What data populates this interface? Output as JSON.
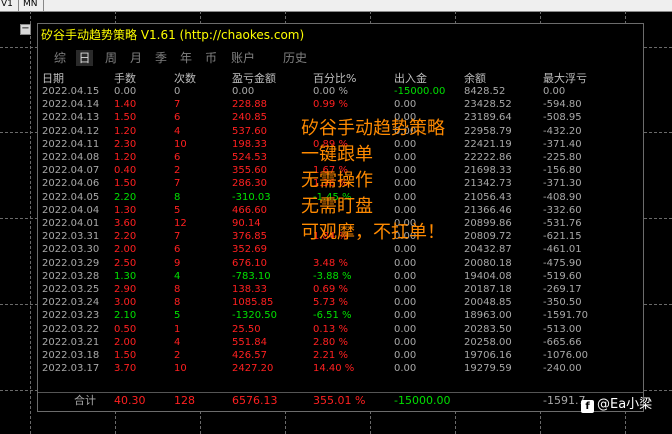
{
  "toolbar": {
    "left_label": "V1",
    "right_label": "MN"
  },
  "panel": {
    "collapse_glyph": "−",
    "title": "矽谷手动趋势策略 V1.61 (http://chaokes.com)",
    "tabs": [
      "综",
      "日",
      "周",
      "月",
      "季",
      "年",
      "币",
      "账户",
      "历史"
    ],
    "active_tab": "日",
    "columns": [
      "日期",
      "手数",
      "次数",
      "盈亏金额",
      "百分比%",
      "出入金",
      "余额",
      "最大浮亏"
    ],
    "rows": [
      {
        "date": "2022.04.15",
        "lots": "0.00",
        "count": "0",
        "pnl": "0.00",
        "pct": "0.00 %",
        "io": "-15000.00",
        "bal": "8428.52",
        "dd": "0.00",
        "color": "grey",
        "io_color": "green"
      },
      {
        "date": "2022.04.14",
        "lots": "1.40",
        "count": "7",
        "pnl": "228.88",
        "pct": "0.99 %",
        "io": "0.00",
        "bal": "23428.52",
        "dd": "-594.80",
        "color": "red",
        "io_color": "grey"
      },
      {
        "date": "2022.04.13",
        "lots": "1.50",
        "count": "6",
        "pnl": "240.85",
        "pct": "",
        "io": "0.00",
        "bal": "23189.64",
        "dd": "-508.95",
        "color": "red",
        "io_color": "grey"
      },
      {
        "date": "2022.04.12",
        "lots": "1.20",
        "count": "4",
        "pnl": "537.60",
        "pct": "",
        "io": "0.00",
        "bal": "22958.79",
        "dd": "-432.20",
        "color": "red",
        "io_color": "grey"
      },
      {
        "date": "2022.04.11",
        "lots": "2.30",
        "count": "10",
        "pnl": "198.33",
        "pct": "0.89 %",
        "io": "0.00",
        "bal": "22421.19",
        "dd": "-371.40",
        "color": "red",
        "io_color": "grey"
      },
      {
        "date": "2022.04.08",
        "lots": "1.20",
        "count": "6",
        "pnl": "524.53",
        "pct": "",
        "io": "0.00",
        "bal": "22222.86",
        "dd": "-225.80",
        "color": "red",
        "io_color": "grey"
      },
      {
        "date": "2022.04.07",
        "lots": "0.40",
        "count": "2",
        "pnl": "355.60",
        "pct": "1.67 %",
        "io": "0.00",
        "bal": "21698.33",
        "dd": "-156.80",
        "color": "red",
        "io_color": "grey"
      },
      {
        "date": "2022.04.06",
        "lots": "1.50",
        "count": "7",
        "pnl": "286.30",
        "pct": "1.36 %",
        "io": "0.00",
        "bal": "21342.73",
        "dd": "-371.30",
        "color": "red",
        "io_color": "grey"
      },
      {
        "date": "2022.04.05",
        "lots": "2.20",
        "count": "8",
        "pnl": "-310.03",
        "pct": "-1.45 %",
        "io": "0.00",
        "bal": "21056.43",
        "dd": "-408.90",
        "color": "green",
        "io_color": "grey"
      },
      {
        "date": "2022.04.04",
        "lots": "1.30",
        "count": "5",
        "pnl": "466.60",
        "pct": "",
        "io": "0.00",
        "bal": "21366.46",
        "dd": "-332.60",
        "color": "red",
        "io_color": "grey"
      },
      {
        "date": "2022.04.01",
        "lots": "3.60",
        "count": "12",
        "pnl": "90.14",
        "pct": "",
        "io": "0.00",
        "bal": "20899.86",
        "dd": "-531.76",
        "color": "red",
        "io_color": "grey"
      },
      {
        "date": "2022.03.31",
        "lots": "2.20",
        "count": "7",
        "pnl": "376.85",
        "pct": "1.84 %",
        "io": "0.00",
        "bal": "20809.72",
        "dd": "-621.15",
        "color": "red",
        "io_color": "grey"
      },
      {
        "date": "2022.03.30",
        "lots": "2.00",
        "count": "6",
        "pnl": "352.69",
        "pct": "",
        "io": "0.00",
        "bal": "20432.87",
        "dd": "-461.01",
        "color": "red",
        "io_color": "grey"
      },
      {
        "date": "2022.03.29",
        "lots": "2.50",
        "count": "9",
        "pnl": "676.10",
        "pct": "3.48 %",
        "io": "0.00",
        "bal": "20080.18",
        "dd": "-475.90",
        "color": "red",
        "io_color": "grey"
      },
      {
        "date": "2022.03.28",
        "lots": "1.30",
        "count": "4",
        "pnl": "-783.10",
        "pct": "-3.88 %",
        "io": "0.00",
        "bal": "19404.08",
        "dd": "-519.60",
        "color": "green",
        "io_color": "grey"
      },
      {
        "date": "2022.03.25",
        "lots": "2.90",
        "count": "8",
        "pnl": "138.33",
        "pct": "0.69 %",
        "io": "0.00",
        "bal": "20187.18",
        "dd": "-269.17",
        "color": "red",
        "io_color": "grey"
      },
      {
        "date": "2022.03.24",
        "lots": "3.00",
        "count": "8",
        "pnl": "1085.85",
        "pct": "5.73 %",
        "io": "0.00",
        "bal": "20048.85",
        "dd": "-350.50",
        "color": "red",
        "io_color": "grey"
      },
      {
        "date": "2022.03.23",
        "lots": "2.10",
        "count": "5",
        "pnl": "-1320.50",
        "pct": "-6.51 %",
        "io": "0.00",
        "bal": "18963.00",
        "dd": "-1591.70",
        "color": "green",
        "io_color": "grey"
      },
      {
        "date": "2022.03.22",
        "lots": "0.50",
        "count": "1",
        "pnl": "25.50",
        "pct": "0.13 %",
        "io": "0.00",
        "bal": "20283.50",
        "dd": "-513.00",
        "color": "red",
        "io_color": "grey"
      },
      {
        "date": "2022.03.21",
        "lots": "2.00",
        "count": "4",
        "pnl": "551.84",
        "pct": "2.80 %",
        "io": "0.00",
        "bal": "20258.00",
        "dd": "-665.66",
        "color": "red",
        "io_color": "grey"
      },
      {
        "date": "2022.03.18",
        "lots": "1.50",
        "count": "2",
        "pnl": "426.57",
        "pct": "2.21 %",
        "io": "0.00",
        "bal": "19706.16",
        "dd": "-1076.00",
        "color": "red",
        "io_color": "grey"
      },
      {
        "date": "2022.03.17",
        "lots": "3.70",
        "count": "10",
        "pnl": "2427.20",
        "pct": "14.40 %",
        "io": "0.00",
        "bal": "19279.59",
        "dd": "-240.00",
        "color": "red",
        "io_color": "grey"
      }
    ],
    "totals": {
      "label": "合计",
      "lots": "40.30",
      "count": "128",
      "pnl": "6576.13",
      "pct": "355.01 %",
      "io": "-15000.00",
      "dd": "-1591.7"
    }
  },
  "overlay_lines": [
    "矽谷手动趋势策略",
    "一键跟单",
    "无需操作",
    "无需盯盘",
    "可观摩，不扛单！"
  ],
  "watermark": {
    "icon_glyph": "f",
    "text": "@Ea小梁"
  },
  "colors": {
    "red": "#ff2020",
    "green": "#00e000",
    "grey": "#a8a8a8",
    "title": "#ffff00",
    "overlay": "#ff8a00"
  }
}
